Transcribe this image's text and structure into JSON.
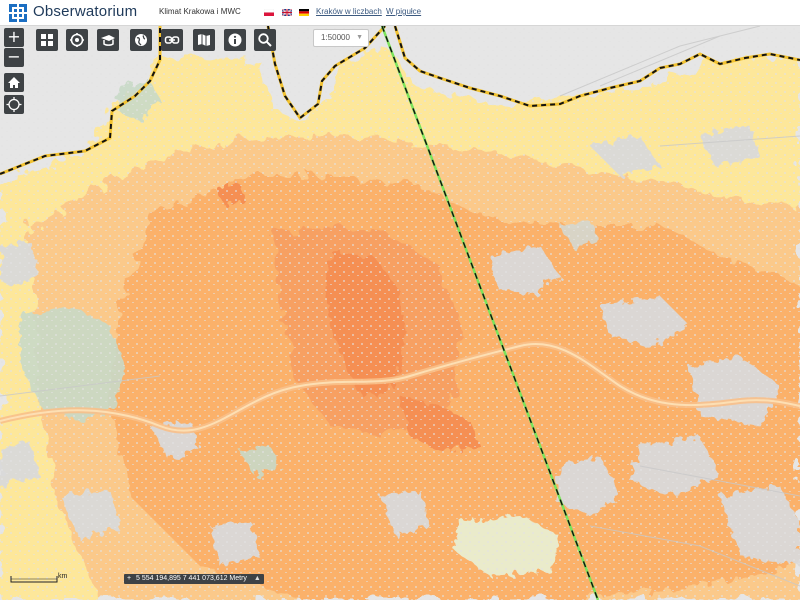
{
  "header": {
    "title": "Obserwatorium",
    "subtitle": "Klimat Krakowa i MWC",
    "links": [
      "Kraków w liczbach",
      "W pigułce"
    ]
  },
  "map_controls": {
    "zoom_in": "+",
    "zoom_out": "−",
    "scale": "1:50000",
    "tools": [
      "layers-icon",
      "legend-icon",
      "info-layers-icon",
      "globe-icon",
      "link-icon",
      "map-icon",
      "info-icon",
      "search-icon"
    ]
  },
  "status_bar": {
    "scale_unit": "km",
    "coordinates": "5 554 194,895 7 441 073,612 Metry"
  },
  "colors": {
    "accent": "#3e4245",
    "background": "#e6e6e6",
    "light_yellow": "#fde79a",
    "orange": "#fbb16a",
    "dark_orange": "#f58f52",
    "green": "#c9dac8"
  }
}
